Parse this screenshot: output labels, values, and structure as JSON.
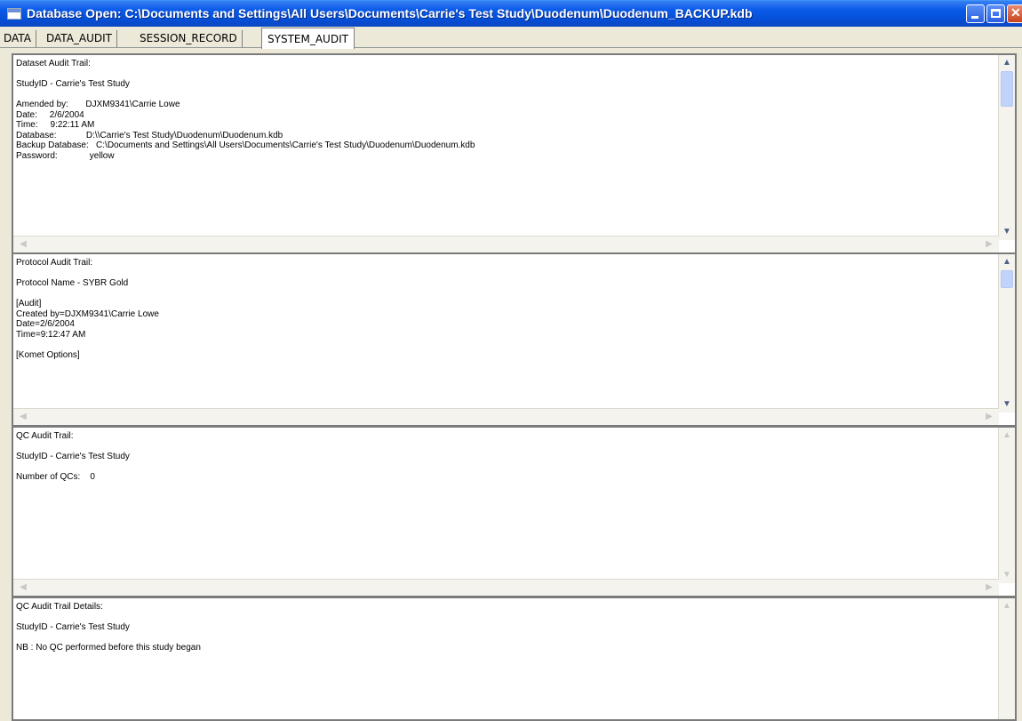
{
  "window": {
    "title": "Database Open: C:\\Documents and Settings\\All Users\\Documents\\Carrie's Test Study\\Duodenum\\Duodenum_BACKUP.kdb"
  },
  "tabs": [
    "DATA",
    "DATA_AUDIT",
    "SESSION_RECORD",
    "SYSTEM_AUDIT"
  ],
  "active_tab": "SYSTEM_AUDIT",
  "panels": {
    "dataset": "Dataset Audit Trail:\n\nStudyID - Carrie's Test Study\n\nAmended by:       DJXM9341\\Carrie Lowe\nDate:     2/6/2004\nTime:     9:22:11 AM\nDatabase:            D:\\\\Carrie's Test Study\\Duodenum\\Duodenum.kdb\nBackup Database:   C:\\Documents and Settings\\All Users\\Documents\\Carrie's Test Study\\Duodenum\\Duodenum.kdb\nPassword:             yellow",
    "protocol": "Protocol Audit Trail:\n\nProtocol Name - SYBR Gold\n\n[Audit]\nCreated by=DJXM9341\\Carrie Lowe\nDate=2/6/2004\nTime=9:12:47 AM\n\n[Komet Options]",
    "qc": "QC Audit Trail:\n\nStudyID - Carrie's Test Study\n\nNumber of QCs:    0",
    "qc_details": "QC Audit Trail Details:\n\nStudyID - Carrie's Test Study\n\nNB : No QC performed before this study began"
  }
}
